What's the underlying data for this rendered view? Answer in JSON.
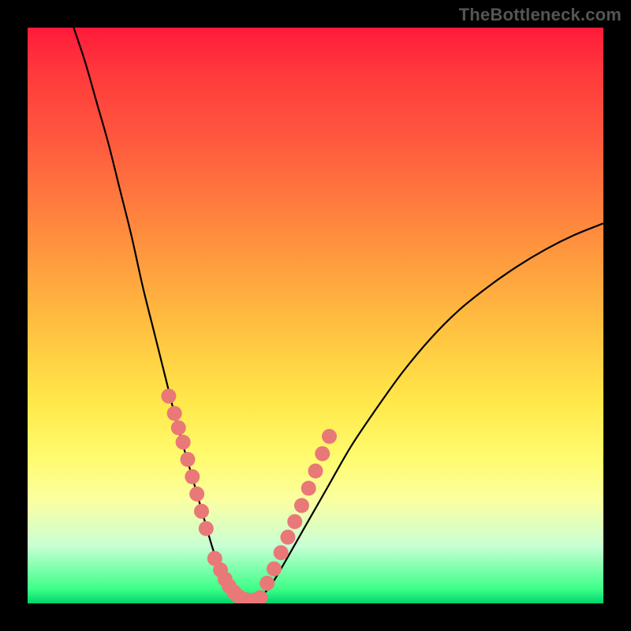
{
  "watermark": "TheBottleneck.com",
  "chart_data": {
    "type": "line",
    "title": "",
    "xlabel": "",
    "ylabel": "",
    "xlim": [
      0,
      100
    ],
    "ylim": [
      0,
      100
    ],
    "series": [
      {
        "name": "bottleneck-curve",
        "x": [
          8,
          10,
          12,
          14,
          16,
          18,
          20,
          22,
          24,
          26,
          28,
          30,
          32,
          33,
          34,
          35,
          36,
          37,
          38.5,
          40,
          42,
          44,
          48,
          52,
          56,
          60,
          65,
          70,
          75,
          80,
          85,
          90,
          95,
          100
        ],
        "values": [
          100,
          94,
          87,
          80,
          72,
          64,
          55,
          47,
          39,
          31,
          24,
          17,
          10,
          7,
          4.5,
          2.8,
          1.6,
          0.8,
          0.3,
          0.8,
          2.8,
          6,
          13,
          20,
          27,
          33,
          40,
          46,
          51,
          55,
          58.5,
          61.5,
          64,
          66
        ]
      }
    ],
    "marker_clusters": [
      {
        "name": "left-cluster",
        "x": [
          24.5,
          25.5,
          26.2,
          27.0,
          27.8,
          28.6,
          29.4,
          30.2,
          31.0
        ],
        "y": [
          36,
          33,
          30.5,
          28,
          25,
          22,
          19,
          16,
          13
        ]
      },
      {
        "name": "bottom-cluster",
        "x": [
          32.5,
          33.5,
          34.3,
          35.0,
          35.8,
          36.5,
          37.2,
          38.0,
          38.8,
          39.6,
          40.4
        ],
        "y": [
          7.8,
          5.8,
          4.2,
          3.0,
          2.0,
          1.3,
          0.8,
          0.6,
          0.5,
          0.6,
          1.0
        ]
      },
      {
        "name": "right-cluster",
        "x": [
          41.6,
          42.8,
          44.0,
          45.2,
          46.4,
          47.6,
          48.8,
          50.0,
          51.2,
          52.4
        ],
        "y": [
          3.5,
          6.0,
          8.8,
          11.5,
          14.2,
          17.0,
          20.0,
          23.0,
          26.0,
          29.0
        ]
      }
    ],
    "colors": {
      "curve": "#000000",
      "marker_fill": "#e97878",
      "marker_stroke": "#d46868"
    }
  }
}
